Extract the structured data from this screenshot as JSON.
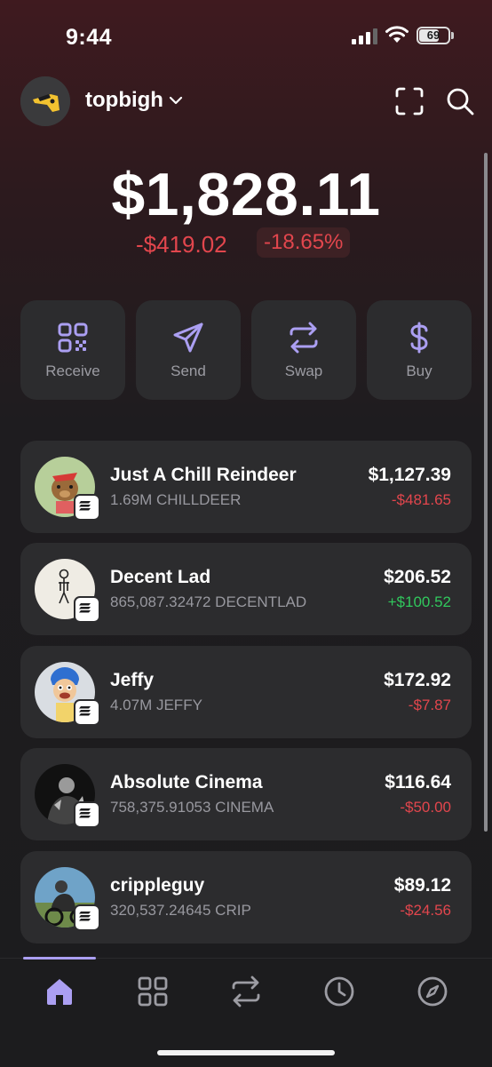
{
  "status_bar": {
    "time": "9:44",
    "battery": "69",
    "battery_level": 0.69
  },
  "header": {
    "username": "topbigh"
  },
  "portfolio": {
    "balance": "$1,828.11",
    "change_amount": "-$419.02",
    "change_percent": "-18.65%"
  },
  "actions": [
    {
      "label": "Receive",
      "icon": "qr-code-icon"
    },
    {
      "label": "Send",
      "icon": "send-icon"
    },
    {
      "label": "Swap",
      "icon": "swap-icon"
    },
    {
      "label": "Buy",
      "icon": "dollar-icon"
    }
  ],
  "tokens": [
    {
      "name": "Just A Chill Reindeer",
      "quantity": "1.69M CHILLDEER",
      "value": "$1,127.39",
      "change": "-$481.65",
      "trend": "negative"
    },
    {
      "name": "Decent Lad",
      "quantity": "865,087.32472 DECENTLAD",
      "value": "$206.52",
      "change": "+$100.52",
      "trend": "positive"
    },
    {
      "name": "Jeffy",
      "quantity": "4.07M JEFFY",
      "value": "$172.92",
      "change": "-$7.87",
      "trend": "negative"
    },
    {
      "name": "Absolute Cinema",
      "quantity": "758,375.91053 CINEMA",
      "value": "$116.64",
      "change": "-$50.00",
      "trend": "negative"
    },
    {
      "name": "crippleguy",
      "quantity": "320,537.24645 CRIP",
      "value": "$89.12",
      "change": "-$24.56",
      "trend": "negative"
    }
  ],
  "tab_bar": [
    {
      "icon": "home-icon",
      "active": true
    },
    {
      "icon": "grid-icon",
      "active": false
    },
    {
      "icon": "swap-icon",
      "active": false
    },
    {
      "icon": "clock-icon",
      "active": false
    },
    {
      "icon": "compass-icon",
      "active": false
    }
  ],
  "colors": {
    "accent": "#ab9ff2",
    "negative": "#e2464d",
    "positive": "#31c85d",
    "card": "#2c2c2e"
  }
}
